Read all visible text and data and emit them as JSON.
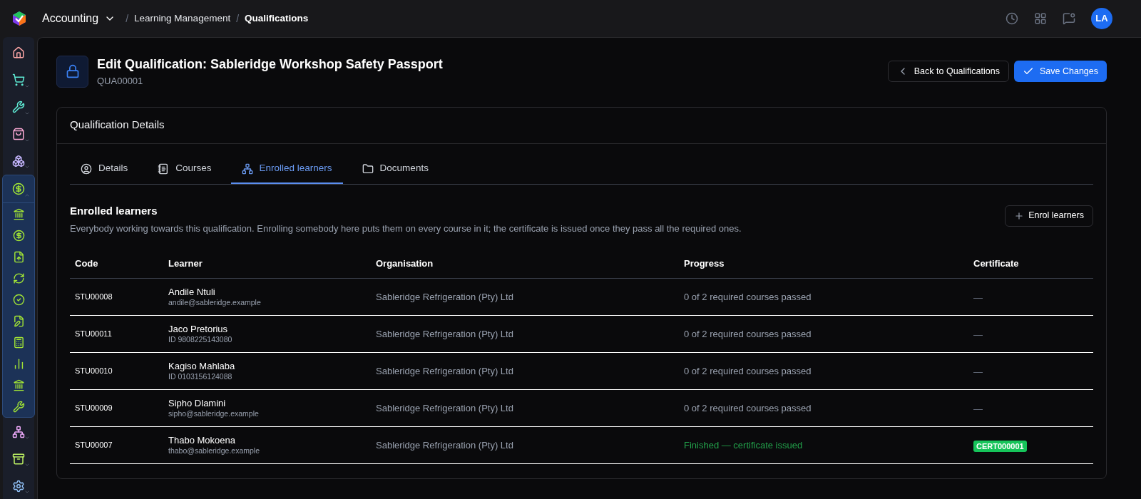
{
  "topbar": {
    "app": "Accounting",
    "breadcrumbs": [
      {
        "separator": "/",
        "label": "Learning Management",
        "current": false
      },
      {
        "separator": "/",
        "label": "Qualifications",
        "current": true
      }
    ],
    "avatar": "LA"
  },
  "sidebar": {
    "items": [
      {
        "expanded": false
      },
      {
        "expanded": false
      },
      {
        "expanded": false
      },
      {
        "expanded": false
      },
      {
        "expanded": true
      },
      {
        "expanded": false
      },
      {
        "expanded": false
      },
      {
        "expanded": false
      }
    ]
  },
  "header": {
    "title": "Edit Qualification: Sableridge Workshop Safety Passport",
    "code": "QUA00001",
    "back_button": "Back to Qualifications",
    "save_button": "Save Changes"
  },
  "card": {
    "title": "Qualification Details",
    "tabs": [
      {
        "label": "Details",
        "selected": false
      },
      {
        "label": "Courses",
        "selected": false
      },
      {
        "label": "Enrolled learners",
        "selected": true
      },
      {
        "label": "Documents",
        "selected": false
      }
    ],
    "section": {
      "title": "Enrolled learners",
      "description": "Everybody working towards this qualification. Enrolling somebody here puts them on every course in it; the certificate is issued once they pass all the required ones.",
      "button": "Enrol learners"
    },
    "table": {
      "columns": [
        "Code",
        "Learner",
        "Organisation",
        "Progress",
        "Certificate"
      ],
      "rows": [
        {
          "code": "STU00008",
          "name": "Andile Ntuli",
          "detail": "andile@sableridge.example",
          "organisation": "Sableridge Refrigeration (Pty) Ltd",
          "progress": "0 of 2 required courses passed",
          "finished": false,
          "certificate": "—"
        },
        {
          "code": "STU00011",
          "name": "Jaco Pretorius",
          "detail": "ID 9808225143080",
          "organisation": "Sableridge Refrigeration (Pty) Ltd",
          "progress": "0 of 2 required courses passed",
          "finished": false,
          "certificate": "—"
        },
        {
          "code": "STU00010",
          "name": "Kagiso Mahlaba",
          "detail": "ID 0103156124088",
          "organisation": "Sableridge Refrigeration (Pty) Ltd",
          "progress": "0 of 2 required courses passed",
          "finished": false,
          "certificate": "—"
        },
        {
          "code": "STU00009",
          "name": "Sipho Dlamini",
          "detail": "sipho@sableridge.example",
          "organisation": "Sableridge Refrigeration (Pty) Ltd",
          "progress": "0 of 2 required courses passed",
          "finished": false,
          "certificate": "—"
        },
        {
          "code": "STU00007",
          "name": "Thabo Mokoena",
          "detail": "thabo@sableridge.example",
          "organisation": "Sableridge Refrigeration (Pty) Ltd",
          "progress": "Finished — certificate issued",
          "finished": true,
          "certificate": "CERT000001"
        }
      ]
    }
  }
}
